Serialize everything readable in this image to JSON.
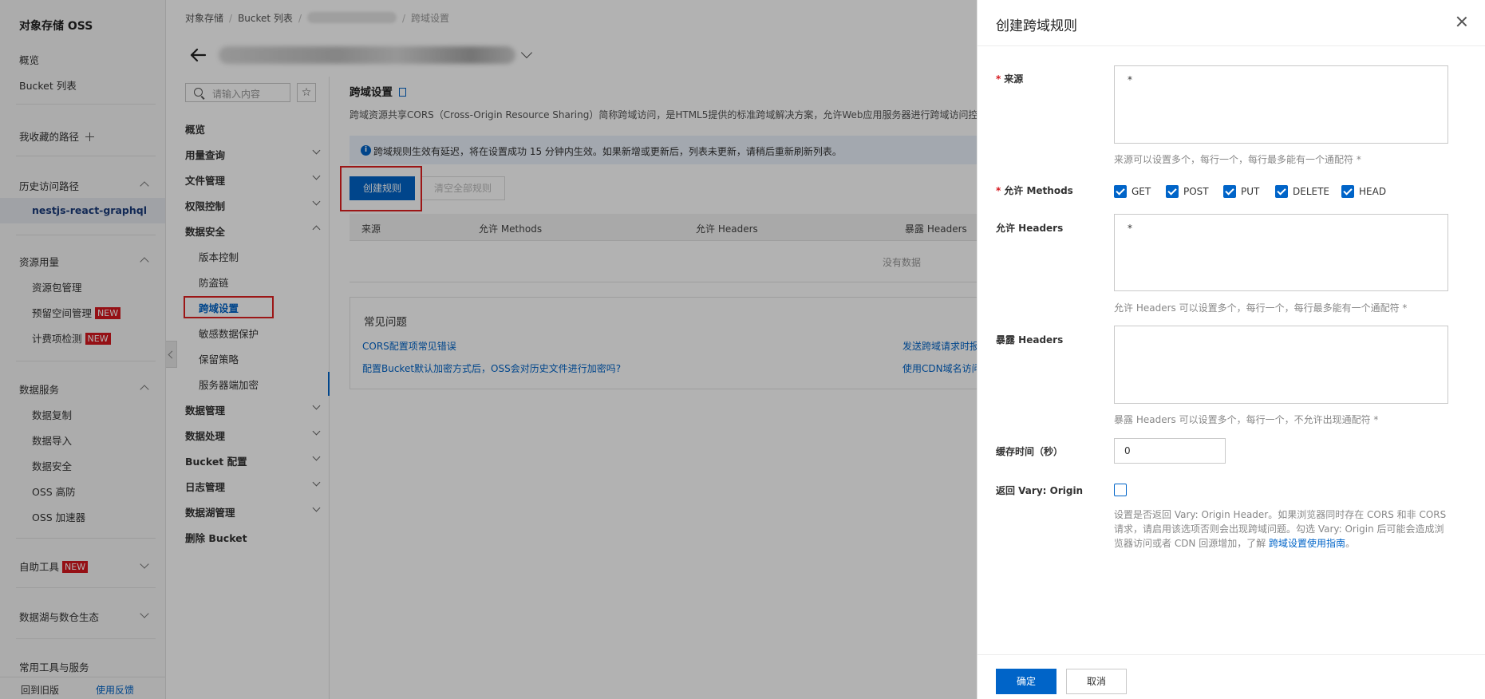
{
  "sidebar": {
    "title": "对象存储 OSS",
    "overview": "概览",
    "bucket_list": "Bucket 列表",
    "favorites": "我收藏的路径",
    "history": "历史访问路径",
    "history_item": "nestjs-react-graphql",
    "resource_usage": "资源用量",
    "resource_pack": "资源包管理",
    "reserved_space": "预留空间管理",
    "billing_check": "计费项检测",
    "new_badge": "NEW",
    "data_services": "数据服务",
    "data_replication": "数据复制",
    "data_import": "数据导入",
    "data_security": "数据安全",
    "oss_ddos": "OSS 高防",
    "oss_accel": "OSS 加速器",
    "self_tools": "自助工具",
    "datalake": "数据湖与数仓生态",
    "common_tools": "常用工具与服务",
    "back_old": "回到旧版",
    "feedback": "使用反馈"
  },
  "breadcrumb": {
    "root": "对象存储",
    "sep": "/",
    "bucket_list": "Bucket 列表",
    "current": "跨域设置"
  },
  "inner_nav": {
    "search_placeholder": "请输入内容",
    "star": "☆",
    "items": [
      {
        "label": "概览"
      },
      {
        "label": "用量查询"
      },
      {
        "label": "文件管理"
      },
      {
        "label": "权限控制"
      },
      {
        "label": "数据安全"
      }
    ],
    "sub_items": [
      {
        "label": "版本控制"
      },
      {
        "label": "防盗链"
      },
      {
        "label": "跨域设置"
      },
      {
        "label": "敏感数据保护"
      },
      {
        "label": "保留策略"
      },
      {
        "label": "服务器端加密"
      }
    ],
    "more_items": [
      {
        "label": "数据管理"
      },
      {
        "label": "数据处理"
      },
      {
        "label": "Bucket 配置"
      },
      {
        "label": "日志管理"
      },
      {
        "label": "数据湖管理"
      },
      {
        "label": "删除 Bucket"
      }
    ]
  },
  "main": {
    "title": "跨域设置",
    "description": "跨域资源共享CORS（Cross-Origin Resource Sharing）简称跨域访问，是HTML5提供的标准跨域解决方案，允许Web应用服务器进行跨域访问控制，",
    "info": "跨域规则生效有延迟，将在设置成功 15 分钟内生效。如果新增或更新后，列表未更新，请稍后重新刷新列表。",
    "info_icon": "i",
    "create_rule": "创建规则",
    "clear_rules": "清空全部规则",
    "columns": [
      "来源",
      "允许 Methods",
      "允许 Headers",
      "暴露 Headers"
    ],
    "empty": "没有数据",
    "faq_title": "常见问题",
    "faq_links": [
      "CORS配置项常见错误",
      "配置Bucket默认加密方式后，OSS会对历史文件进行加密吗?",
      "发送跨域请求时报",
      "使用CDN域名访问"
    ]
  },
  "drawer": {
    "title": "创建跨域规则",
    "origin_label": "来源",
    "origin_value": "*",
    "origin_hint": "来源可以设置多个，每行一个，每行最多能有一个通配符 *",
    "methods_label": "允许 Methods",
    "methods": [
      "GET",
      "POST",
      "PUT",
      "DELETE",
      "HEAD"
    ],
    "allow_headers_label": "允许 Headers",
    "allow_headers_value": "*",
    "allow_headers_hint": "允许 Headers 可以设置多个，每行一个，每行最多能有一个通配符 *",
    "expose_headers_label": "暴露 Headers",
    "expose_headers_value": "",
    "expose_headers_hint": "暴露 Headers 可以设置多个，每行一个，不允许出现通配符 *",
    "cache_label": "缓存时间（秒）",
    "cache_value": "0",
    "vary_label": "返回 Vary: Origin",
    "vary_hint": "设置是否返回 Vary: Origin Header。如果浏览器同时存在 CORS 和非 CORS 请求，请启用该选项否则会出现跨域问题。勾选 Vary: Origin 后可能会造成浏览器访问或者 CDN 回源增加，了解 ",
    "vary_link": "跨域设置使用指南",
    "vary_hint_end": "。",
    "required_mark": "*",
    "ok": "确定",
    "cancel": "取消"
  }
}
